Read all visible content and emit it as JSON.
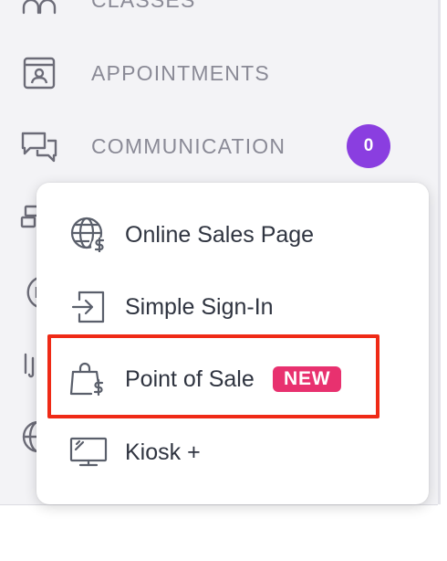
{
  "sidebar": {
    "items": [
      {
        "label": "CLASSES",
        "icon": "classes-icon"
      },
      {
        "label": "APPOINTMENTS",
        "icon": "appointments-icon"
      },
      {
        "label": "COMMUNICATION",
        "icon": "communication-icon",
        "badge": "0"
      }
    ],
    "partial_icons": [
      "integrations-icon",
      "dollar-icon",
      "shop-icon",
      "globe-icon"
    ]
  },
  "popup_menu": {
    "items": [
      {
        "label": "Online Sales Page",
        "icon": "globe-dollar-icon"
      },
      {
        "label": "Simple Sign-In",
        "icon": "sign-in-icon"
      },
      {
        "label": "Point of Sale",
        "icon": "shopping-bag-dollar-icon",
        "badge": "NEW",
        "highlighted": true
      },
      {
        "label": "Kiosk +",
        "icon": "kiosk-monitor-icon"
      }
    ]
  },
  "colors": {
    "sidebar_bg": "#f3f3f6",
    "nav_text": "#8a8a96",
    "badge_purple": "#8a3ee0",
    "new_badge_pink": "#e8316f",
    "highlight_red": "#ef2a16",
    "menu_text": "#2f3440"
  }
}
